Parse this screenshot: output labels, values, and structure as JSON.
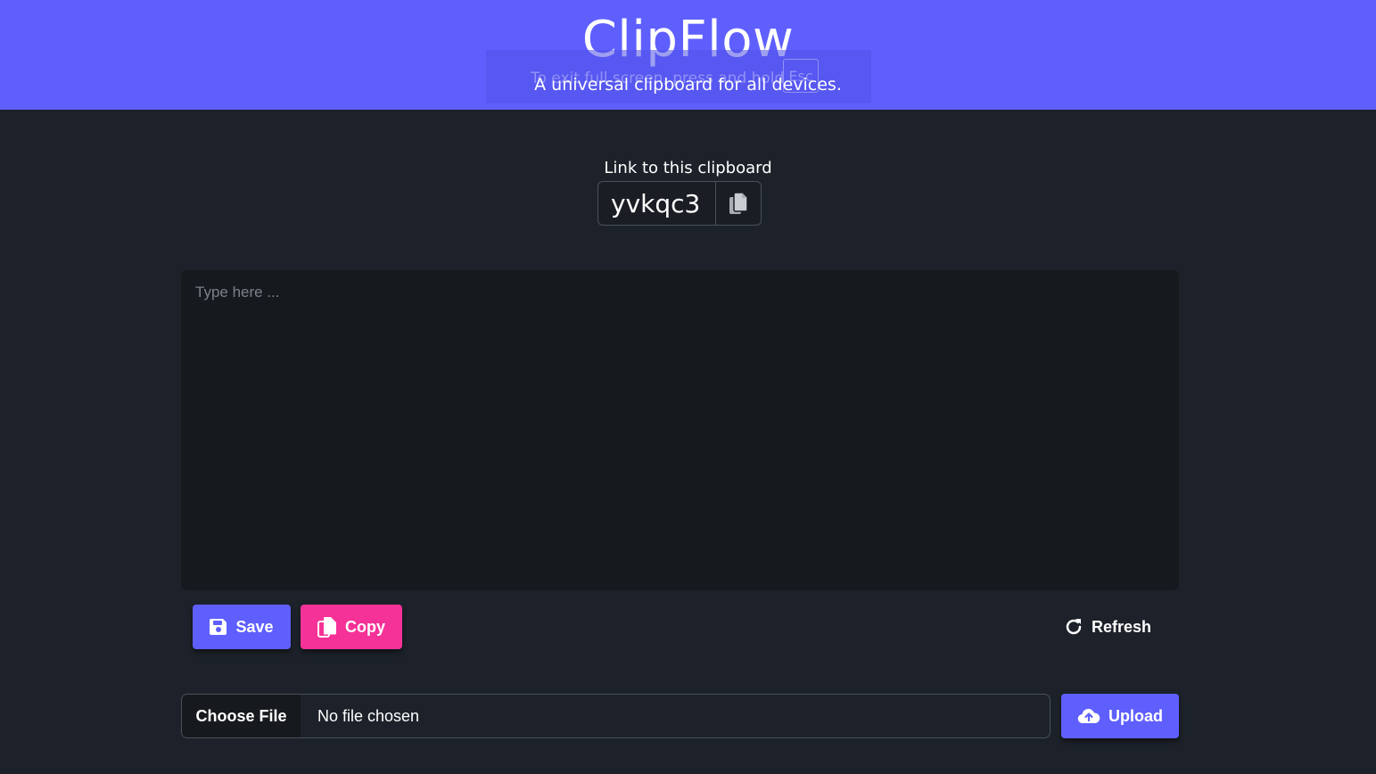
{
  "header": {
    "title": "ClipFlow",
    "subtitle": "A universal clipboard for all devices.",
    "fullscreen_notice": {
      "text": "To exit full screen, press and hold",
      "key": "Esc"
    }
  },
  "link": {
    "label": "Link to this clipboard",
    "code": "yvkqc3",
    "copy_icon": "copy-icon"
  },
  "editor": {
    "value": "",
    "placeholder": "Type here ..."
  },
  "actions": {
    "save_label": "Save",
    "save_icon": "floppy-disk-icon",
    "copy_label": "Copy",
    "copy_icon": "copy-icon",
    "refresh_label": "Refresh",
    "refresh_icon": "refresh-icon"
  },
  "file": {
    "choose_label": "Choose File",
    "status": "No file chosen",
    "upload_label": "Upload",
    "upload_icon": "cloud-upload-icon"
  },
  "colors": {
    "primary": "#5f5ffe",
    "accent": "#f43297",
    "background": "#1d222a",
    "editor_background": "#16191d"
  }
}
